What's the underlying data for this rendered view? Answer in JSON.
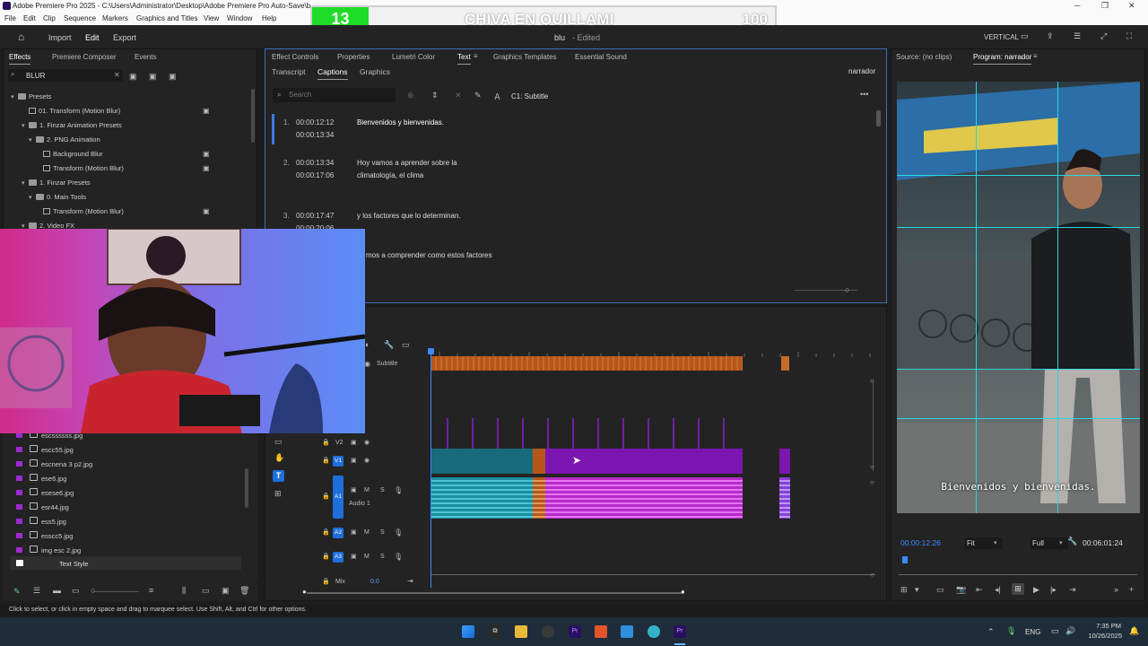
{
  "window": {
    "title": "Adobe Premiere Pro 2025 - C:\\Users\\Administrator\\Desktop\\Adobe Premiere Pro Auto-Save\\b"
  },
  "menu": [
    "File",
    "Edit",
    "Clip",
    "Sequence",
    "Markers",
    "Graphics and Titles",
    "View",
    "Window",
    "Help"
  ],
  "overlay": {
    "level": "13",
    "title": "CHIVA EN QUILLAMI",
    "value": "100",
    "accent": "#1fdc28"
  },
  "header": {
    "import": "Import",
    "edit": "Edit",
    "export": "Export",
    "project": "blu",
    "state": "- Edited",
    "workspace": "VERTICAL"
  },
  "effects_panel": {
    "tabs": [
      "Effects",
      "Premiere Composer",
      "Events"
    ],
    "search_value": "BLUR",
    "tree": [
      "Presets",
      "01. Transform (Motion Blur)",
      "1. Finzar Animation Presets",
      "2. PNG Animation",
      "Background Blur",
      "Transform (Motion Blur)",
      "1. Finzar Presets",
      "0. Main Tools",
      "Transform (Motion Blur)",
      "2. Video FX"
    ]
  },
  "project_files": [
    "escssssss.jpg",
    "escc55.jpg",
    "escnena 3 p2.jpg",
    "ese6.jpg",
    "esese6.jpg",
    "esr44.jpg",
    "ess5.jpg",
    "esscc5.jpg",
    "img esc 2.jpg",
    "Text Style"
  ],
  "text_panel": {
    "tabs": [
      "Effect Controls",
      "Properties",
      "Lumetri Color",
      "Text",
      "Graphics Templates",
      "Essential Sound"
    ],
    "subtabs": [
      "Transcript",
      "Captions",
      "Graphics"
    ],
    "track_name": "narrador",
    "search_placeholder": "Search",
    "caption_track": "C1: Subtitle",
    "captions": [
      {
        "idx": "1.",
        "in": "00:00:12:12",
        "out": "00:00:13:34",
        "text": "Bienvenidos y bienvenidas.",
        "text2": ""
      },
      {
        "idx": "2.",
        "in": "00:00:13:34",
        "out": "00:00:17:06",
        "text": "Hoy vamos a aprender sobre la",
        "text2": "climatología, el clima"
      },
      {
        "idx": "3.",
        "in": "00:00:17:47",
        "out": "00:00:20:06",
        "text": "y los factores que lo determinan.",
        "text2": ""
      },
      {
        "idx": "",
        "in": "",
        "out": "",
        "text": "mos a comprender como estos factores",
        "text2": ""
      }
    ]
  },
  "timeline": {
    "tracks": {
      "subtitle": "Subtitle",
      "v2": "V2",
      "v1": "V1",
      "a1": "A1",
      "a1_name": "Audio 1",
      "a2": "A2",
      "a3": "A3",
      "mix": "Mix",
      "mix_value": "0.0",
      "m": "M",
      "s": "S"
    }
  },
  "source": {
    "label": "Source: (no clips)"
  },
  "program": {
    "label": "Program: narrador",
    "subtitle": "Bienvenidos y bienvenidas.",
    "timecode": "00:00:12:26",
    "fit": "Fit",
    "quality": "Full",
    "duration": "00:06:01:24",
    "guide_color": "#27d7e0"
  },
  "status": {
    "text": "Click to select, or click in empty space and drag to marquee select. Use Shift, Alt, and Ctrl for other options."
  },
  "taskbar": {
    "lang": "ENG",
    "time": "7:35 PM",
    "date": "10/26/2025"
  }
}
